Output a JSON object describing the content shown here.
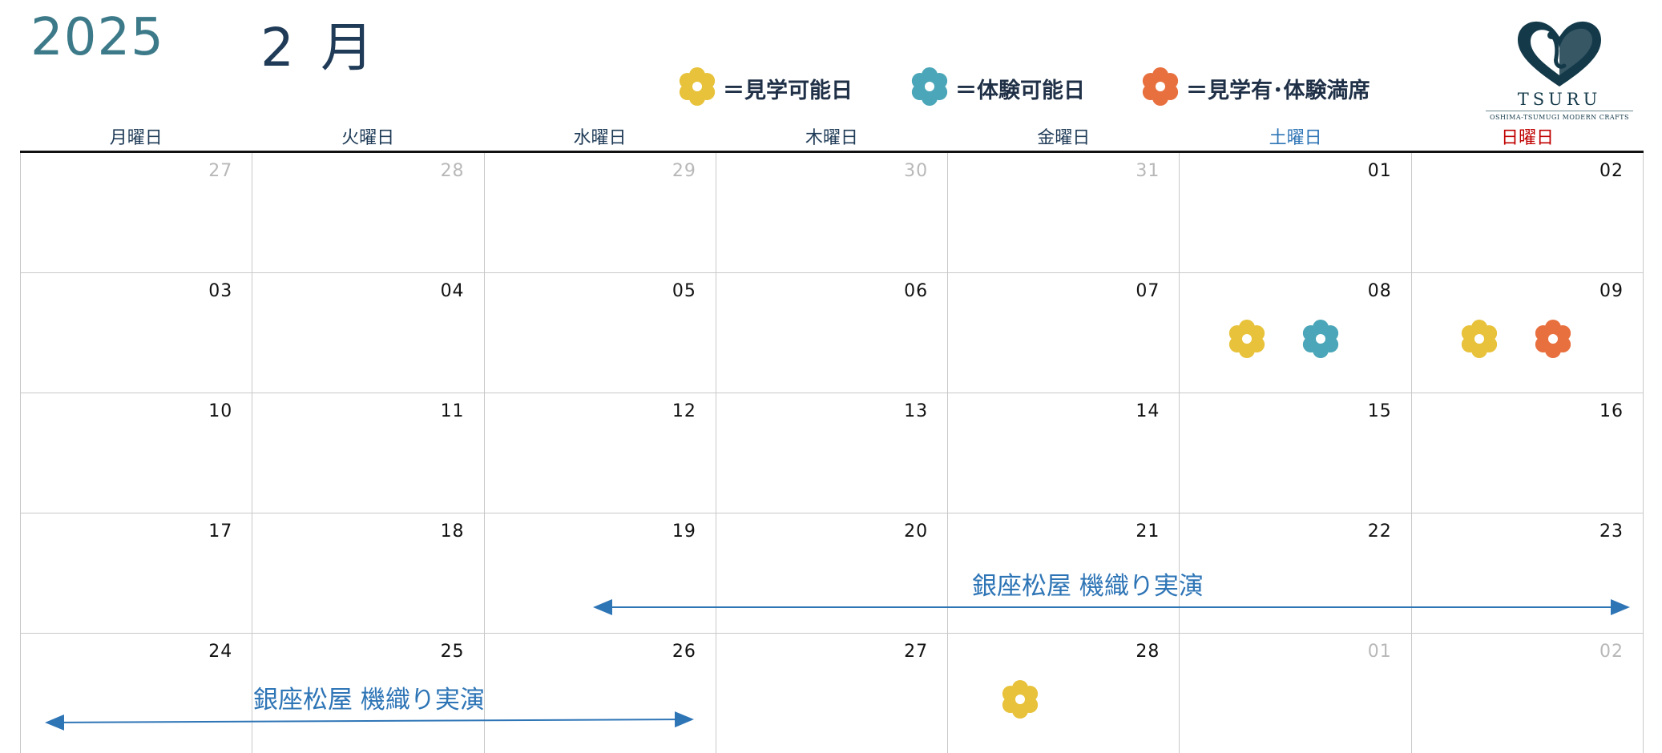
{
  "header": {
    "year": "2025",
    "month": "2 月"
  },
  "legend": [
    {
      "icon": "flower-icon",
      "color": "#e8c23a",
      "label": "＝見学可能日"
    },
    {
      "icon": "flower-icon",
      "color": "#4aa6b8",
      "label": "＝体験可能日"
    },
    {
      "icon": "flower-icon",
      "color": "#e8703f",
      "label": "＝見学有･体験満席"
    }
  ],
  "logo": {
    "word": "TSURU",
    "subtitle": "OSHIMA-TSUMUGI MODERN CRAFTS"
  },
  "weekdays": [
    "月曜日",
    "火曜日",
    "水曜日",
    "木曜日",
    "金曜日",
    "土曜日",
    "日曜日"
  ],
  "colors": {
    "yellow": "#e8c23a",
    "teal": "#4aa6b8",
    "orange": "#e8703f",
    "saturday": "#2e75b6",
    "sunday": "#c00000",
    "event": "#2e75b6"
  },
  "weeks": [
    [
      {
        "day": "27",
        "muted": true,
        "flowers": []
      },
      {
        "day": "28",
        "muted": true,
        "flowers": []
      },
      {
        "day": "29",
        "muted": true,
        "flowers": []
      },
      {
        "day": "30",
        "muted": true,
        "flowers": []
      },
      {
        "day": "31",
        "muted": true,
        "flowers": []
      },
      {
        "day": "01",
        "muted": false,
        "flowers": []
      },
      {
        "day": "02",
        "muted": false,
        "flowers": []
      }
    ],
    [
      {
        "day": "03",
        "muted": false,
        "flowers": []
      },
      {
        "day": "04",
        "muted": false,
        "flowers": []
      },
      {
        "day": "05",
        "muted": false,
        "flowers": []
      },
      {
        "day": "06",
        "muted": false,
        "flowers": []
      },
      {
        "day": "07",
        "muted": false,
        "flowers": []
      },
      {
        "day": "08",
        "muted": false,
        "flowers": [
          "yellow",
          "teal"
        ]
      },
      {
        "day": "09",
        "muted": false,
        "flowers": [
          "yellow",
          "orange"
        ]
      }
    ],
    [
      {
        "day": "10",
        "muted": false,
        "flowers": []
      },
      {
        "day": "11",
        "muted": false,
        "flowers": []
      },
      {
        "day": "12",
        "muted": false,
        "flowers": []
      },
      {
        "day": "13",
        "muted": false,
        "flowers": []
      },
      {
        "day": "14",
        "muted": false,
        "flowers": []
      },
      {
        "day": "15",
        "muted": false,
        "flowers": []
      },
      {
        "day": "16",
        "muted": false,
        "flowers": []
      }
    ],
    [
      {
        "day": "17",
        "muted": false,
        "flowers": []
      },
      {
        "day": "18",
        "muted": false,
        "flowers": []
      },
      {
        "day": "19",
        "muted": false,
        "flowers": []
      },
      {
        "day": "20",
        "muted": false,
        "flowers": []
      },
      {
        "day": "21",
        "muted": false,
        "flowers": []
      },
      {
        "day": "22",
        "muted": false,
        "flowers": []
      },
      {
        "day": "23",
        "muted": false,
        "flowers": []
      }
    ],
    [
      {
        "day": "24",
        "muted": false,
        "flowers": []
      },
      {
        "day": "25",
        "muted": false,
        "flowers": []
      },
      {
        "day": "26",
        "muted": false,
        "flowers": []
      },
      {
        "day": "27",
        "muted": false,
        "flowers": []
      },
      {
        "day": "28",
        "muted": false,
        "flowers": [
          "yellow"
        ]
      },
      {
        "day": "01",
        "muted": true,
        "flowers": []
      },
      {
        "day": "02",
        "muted": true,
        "flowers": []
      }
    ]
  ],
  "events": [
    {
      "label": "銀座松屋 機織り実演"
    },
    {
      "label": "銀座松屋 機織り実演"
    }
  ]
}
